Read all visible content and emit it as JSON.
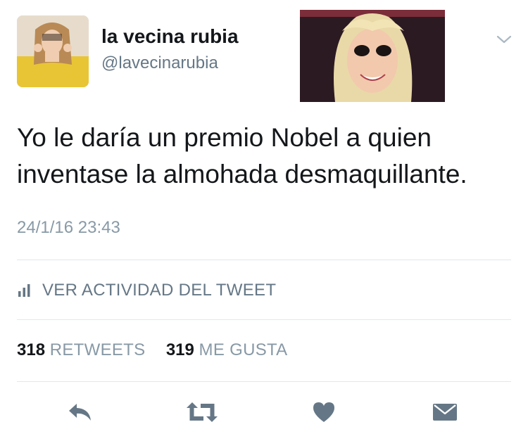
{
  "tweet": {
    "author": {
      "display_name": "la vecina rubia",
      "handle": "@lavecinarubia"
    },
    "text": "Yo le daría un premio Nobel a quien inventase la almohada desmaquillante.",
    "timestamp": "24/1/16 23:43",
    "activity_label": "VER ACTIVIDAD DEL TWEET",
    "stats": {
      "retweets_count": "318",
      "retweets_label": "RETWEETS",
      "likes_count": "319",
      "likes_label": "ME GUSTA"
    },
    "actions": [
      {
        "name": "reply-icon"
      },
      {
        "name": "retweet-icon"
      },
      {
        "name": "like-heart-icon"
      },
      {
        "name": "direct-message-icon"
      }
    ]
  },
  "colors": {
    "text_primary": "#14171a",
    "text_secondary": "#657786",
    "text_muted": "#8899a6",
    "icon_gray": "#657786",
    "divider": "#e1e8ed"
  }
}
